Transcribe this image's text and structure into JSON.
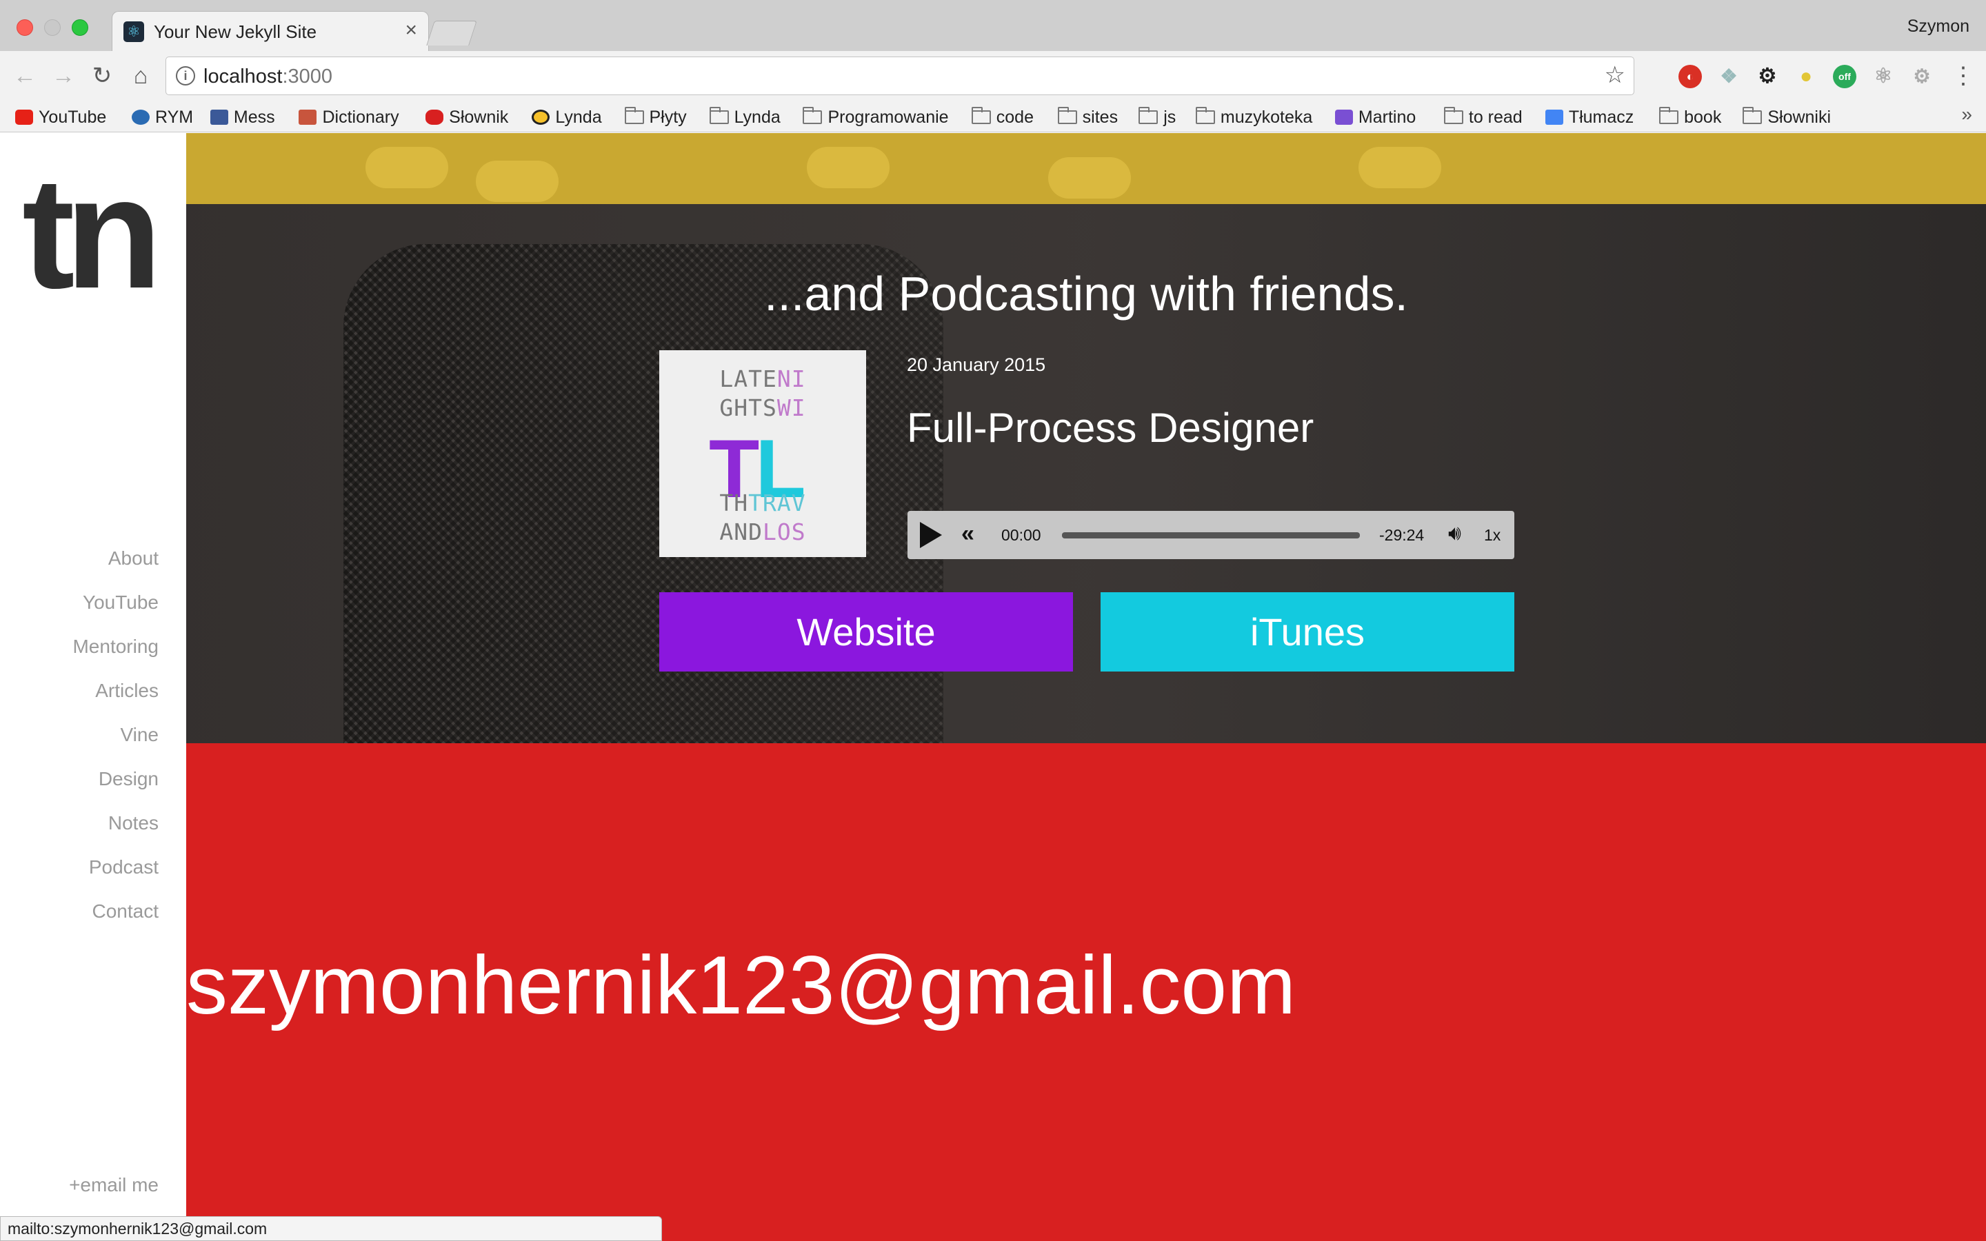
{
  "browser": {
    "tab_title": "Your New Jekyll Site",
    "tab_close": "×",
    "profile": "Szymon",
    "url_host": "localhost",
    "url_port": ":3000",
    "bookmarks": [
      {
        "label": "YouTube",
        "icon": "youtube-icon"
      },
      {
        "label": "RYM",
        "icon": "rym-icon"
      },
      {
        "label": "Mess",
        "icon": "facebook-icon"
      },
      {
        "label": "Dictionary",
        "icon": "cambridge-icon"
      },
      {
        "label": "Słownik",
        "icon": "diki-icon"
      },
      {
        "label": "Lynda",
        "icon": "lynda-icon"
      },
      {
        "label": "Płyty",
        "icon": "folder-icon"
      },
      {
        "label": "Lynda",
        "icon": "folder-icon"
      },
      {
        "label": "Programowanie",
        "icon": "folder-icon"
      },
      {
        "label": "code",
        "icon": "folder-icon"
      },
      {
        "label": "sites",
        "icon": "folder-icon"
      },
      {
        "label": "js",
        "icon": "folder-icon"
      },
      {
        "label": "muzykoteka",
        "icon": "folder-icon"
      },
      {
        "label": "Martino",
        "icon": "martino-icon"
      },
      {
        "label": "to read",
        "icon": "folder-icon"
      },
      {
        "label": "Tłumacz",
        "icon": "google-translate-icon"
      },
      {
        "label": "book",
        "icon": "folder-icon"
      },
      {
        "label": "Słowniki",
        "icon": "folder-icon"
      }
    ],
    "bookmarks_more": "»",
    "status_url": "mailto:szymonhernik123@gmail.com"
  },
  "sidebar": {
    "logo": "tn",
    "nav": [
      "About",
      "YouTube",
      "Mentoring",
      "Articles",
      "Vine",
      "Design",
      "Notes",
      "Podcast",
      "Contact"
    ],
    "email_me": "+email me"
  },
  "podcast": {
    "heading": "...and Podcasting with friends.",
    "cover_lines": [
      {
        "a": "LATE",
        "b": "NI",
        "b_color": "p"
      },
      {
        "a": "GHTS",
        "b": "WI",
        "b_color": "p"
      },
      {
        "a": "TH",
        "b": "TRAV",
        "b_color": "c"
      },
      {
        "a": "AND",
        "b": "LOS",
        "b_color": "p"
      }
    ],
    "cover_t": "T",
    "cover_l": "L",
    "date": "20 January 2015",
    "title": "Full-Process Designer",
    "player": {
      "current_time": "00:00",
      "remaining_time": "-29:24",
      "speed": "1x",
      "progress": 0
    },
    "website_button": "Website",
    "itunes_button": "iTunes"
  },
  "contact": {
    "email": "szymonhernik123@gmail.com"
  },
  "colors": {
    "website": "#8b17de",
    "itunes": "#13cadf",
    "contact_bg": "#d82020",
    "yellow_band": "#c9a831"
  }
}
